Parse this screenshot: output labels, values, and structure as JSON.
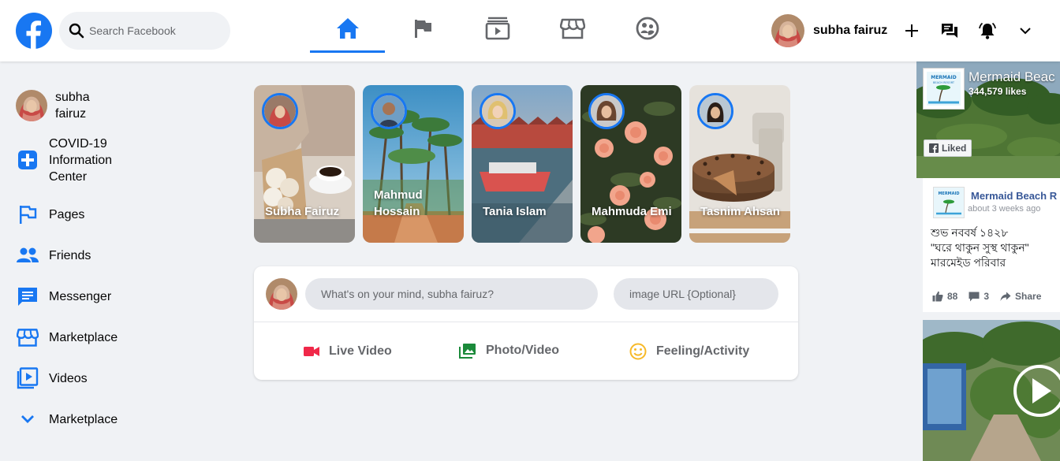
{
  "header": {
    "search_placeholder": "Search Facebook",
    "user_name": "subha fairuz",
    "nav_tabs": [
      "home",
      "pages",
      "watch",
      "marketplace",
      "groups"
    ],
    "active_tab": "home"
  },
  "sidebar": {
    "user_name": "subha fairuz",
    "items": [
      {
        "label": "COVID-19 Information Center",
        "icon": "plus-square-icon"
      },
      {
        "label": "Pages",
        "icon": "flag-icon"
      },
      {
        "label": "Friends",
        "icon": "friends-icon"
      },
      {
        "label": "Messenger",
        "icon": "messenger-icon"
      },
      {
        "label": "Marketplace",
        "icon": "store-icon"
      },
      {
        "label": "Videos",
        "icon": "video-icon"
      },
      {
        "label": "Marketplace",
        "icon": "chevron-down-icon"
      }
    ]
  },
  "stories": [
    {
      "name": "Subha Fairuz"
    },
    {
      "name": "Mahmud Hossain"
    },
    {
      "name": "Tania Islam"
    },
    {
      "name": "Mahmuda Emi"
    },
    {
      "name": "Tasnim Ahsan"
    }
  ],
  "composer": {
    "post_placeholder": "What's on your mind, subha fairuz?",
    "url_placeholder": "image URL {Optional}",
    "actions": [
      {
        "label": "Live Video",
        "icon": "camera-icon",
        "color": "#f02849"
      },
      {
        "label": "Photo/Video",
        "icon": "photo-icon",
        "color": "#45bd62"
      },
      {
        "label": "Feeling/Activity",
        "icon": "smile-icon",
        "color": "#f7b928"
      }
    ]
  },
  "page_widget": {
    "page_name": "Mermaid Beach Resort",
    "cover_title": "Mermaid Beac",
    "likes": "344,579 likes",
    "liked_label": "Liked",
    "post": {
      "author": "Mermaid Beach R",
      "time": "about 3 weeks ago",
      "text": "শুভ নববর্ষ ১৪২৮\n\"ঘরে থাকুন সুস্থ থাকুন\"\nমারমেইড পরিবার",
      "likes": "88",
      "comments": "3",
      "share_label": "Share"
    }
  },
  "colors": {
    "brand": "#1877f2",
    "background": "#f0f2f5",
    "live": "#f02849",
    "photo": "#45bd62",
    "feeling": "#f7b928"
  }
}
